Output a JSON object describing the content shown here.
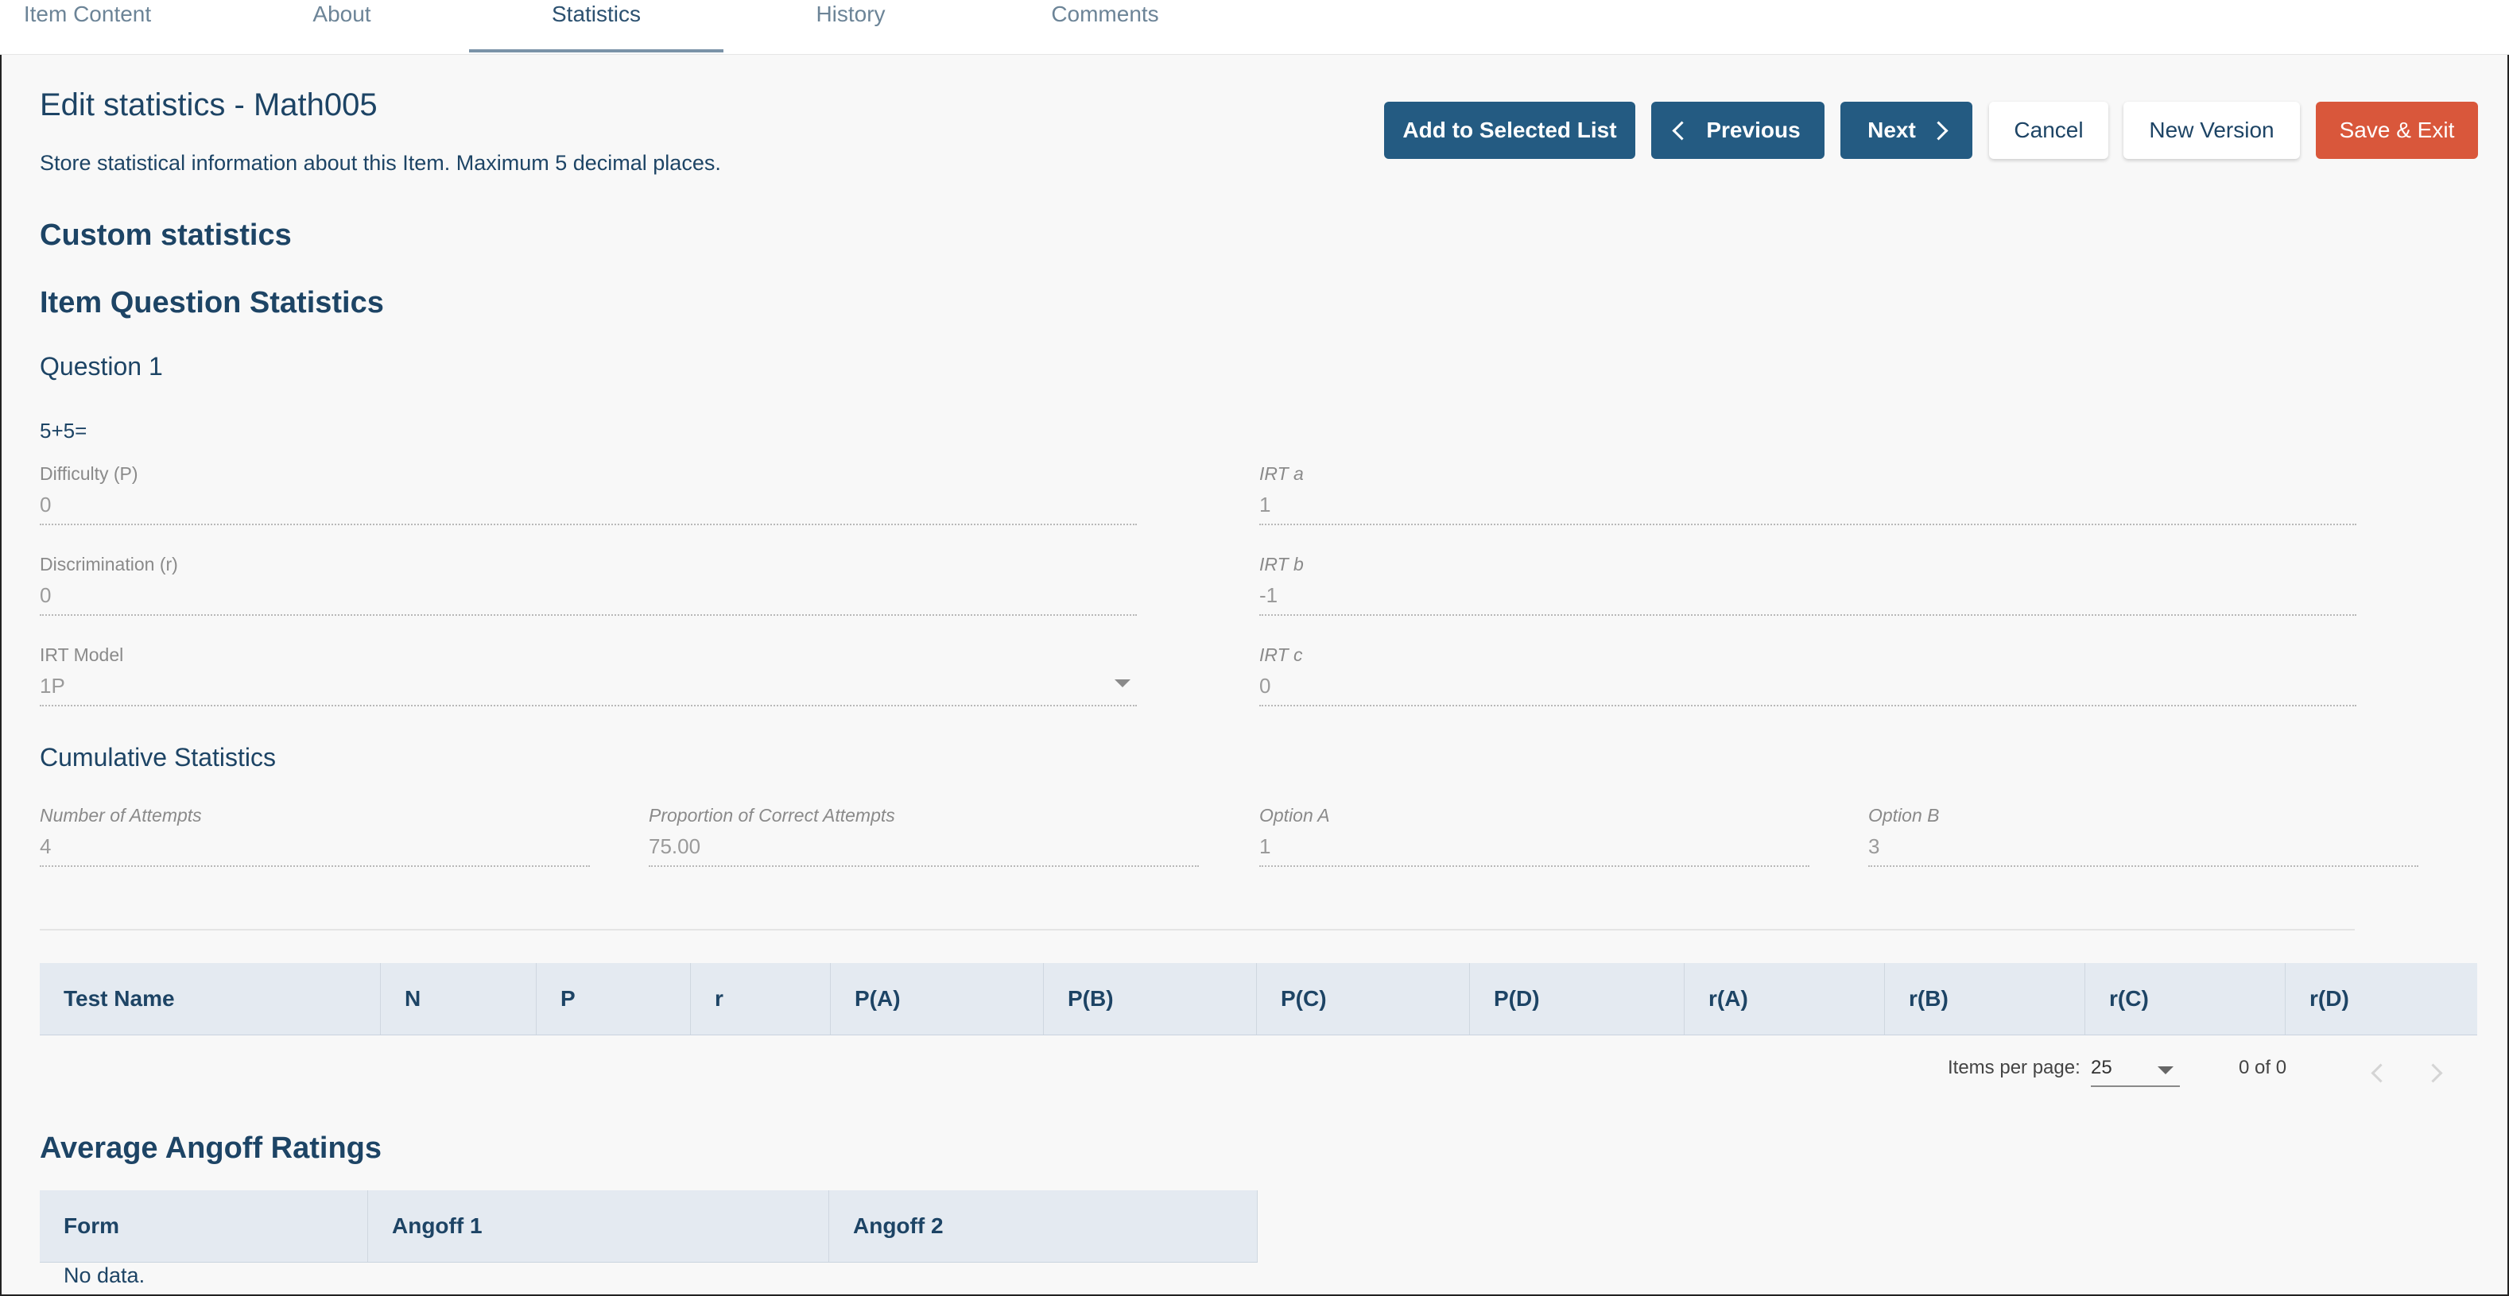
{
  "tabs": [
    {
      "label": "Item Content"
    },
    {
      "label": "About"
    },
    {
      "label": "Statistics"
    },
    {
      "label": "History"
    },
    {
      "label": "Comments"
    }
  ],
  "header": {
    "title": "Edit statistics - Math005",
    "subtitle": "Store statistical information about this Item. Maximum 5 decimal places."
  },
  "toolbar": {
    "add_label": "Add to Selected List",
    "previous_label": "Previous",
    "next_label": "Next",
    "cancel_label": "Cancel",
    "new_version_label": "New Version",
    "save_exit_label": "Save & Exit"
  },
  "sections": {
    "custom": "Custom statistics",
    "item_question": "Item Question Statistics",
    "question": "Question 1",
    "question_text": "5+5=",
    "cumulative": "Cumulative Statistics",
    "angoff": "Average Angoff Ratings"
  },
  "fields": {
    "difficulty": {
      "label": "Difficulty (P)",
      "value": "0"
    },
    "discrimination": {
      "label": "Discrimination (r)",
      "value": "0"
    },
    "irt_model": {
      "label": "IRT Model",
      "value": "1P"
    },
    "irt_a": {
      "label": "IRT a",
      "value": "1"
    },
    "irt_b": {
      "label": "IRT b",
      "value": "-1"
    },
    "irt_c": {
      "label": "IRT c",
      "value": "0"
    }
  },
  "cumulative": {
    "attempts": {
      "label": "Number of Attempts",
      "value": "4"
    },
    "proportion": {
      "label": "Proportion of Correct Attempts",
      "value": "75.00"
    },
    "option_a": {
      "label": "Option A",
      "value": "1"
    },
    "option_b": {
      "label": "Option B",
      "value": "3"
    }
  },
  "test_table": {
    "columns": [
      "Test Name",
      "N",
      "P",
      "r",
      "P(A)",
      "P(B)",
      "P(C)",
      "P(D)",
      "r(A)",
      "r(B)",
      "r(C)",
      "r(D)"
    ]
  },
  "pager": {
    "items_per_page_label": "Items per page:",
    "items_per_page": "25",
    "range": "0 of 0"
  },
  "angoff_table": {
    "columns": [
      "Form",
      "Angoff 1",
      "Angoff 2"
    ],
    "empty": "No data."
  },
  "colors": {
    "primary": "#245b82",
    "danger": "#d9573b",
    "text": "#1d4465"
  }
}
